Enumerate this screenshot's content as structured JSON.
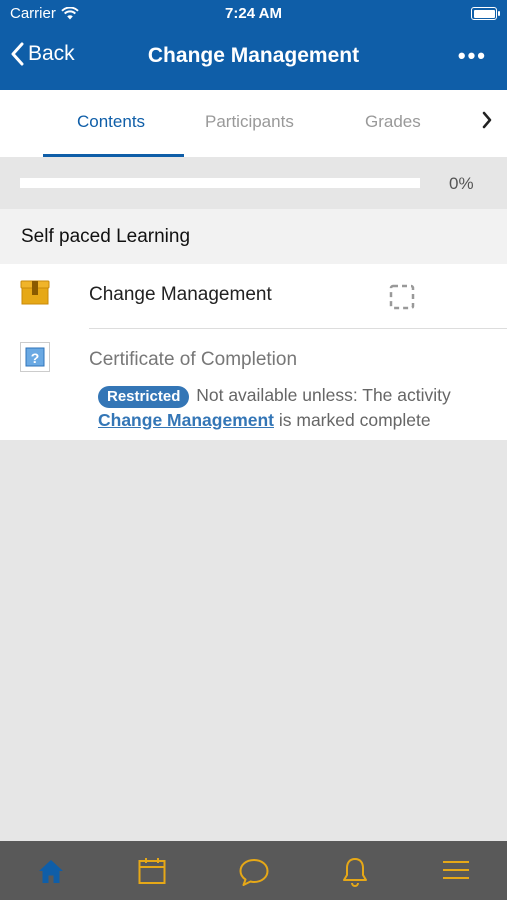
{
  "status_bar": {
    "carrier": "Carrier",
    "time": "7:24 AM"
  },
  "nav": {
    "back_label": "Back",
    "title": "Change Management",
    "more_icon": "more-dots-icon"
  },
  "tabs": [
    {
      "label": "Contents",
      "active": true
    },
    {
      "label": "Participants",
      "active": false
    },
    {
      "label": "Grades",
      "active": false
    }
  ],
  "progress": {
    "text": "0%",
    "value": 0
  },
  "section": {
    "title": "Self paced Learning"
  },
  "items": [
    {
      "title": "Change Management",
      "icon": "package-icon"
    },
    {
      "title": "Certificate of Completion",
      "icon": "certificate-icon"
    }
  ],
  "restriction": {
    "badge": "Restricted",
    "text_before": "Not available unless: The activity",
    "link": "Change Management",
    "text_after": "is marked complete"
  },
  "bottom_nav": [
    "home-icon",
    "calendar-icon",
    "chat-icon",
    "bell-icon",
    "menu-icon"
  ],
  "colors": {
    "brand": "#0f5ea8",
    "accent_yellow": "#e6a817",
    "badge": "#3476b6"
  }
}
